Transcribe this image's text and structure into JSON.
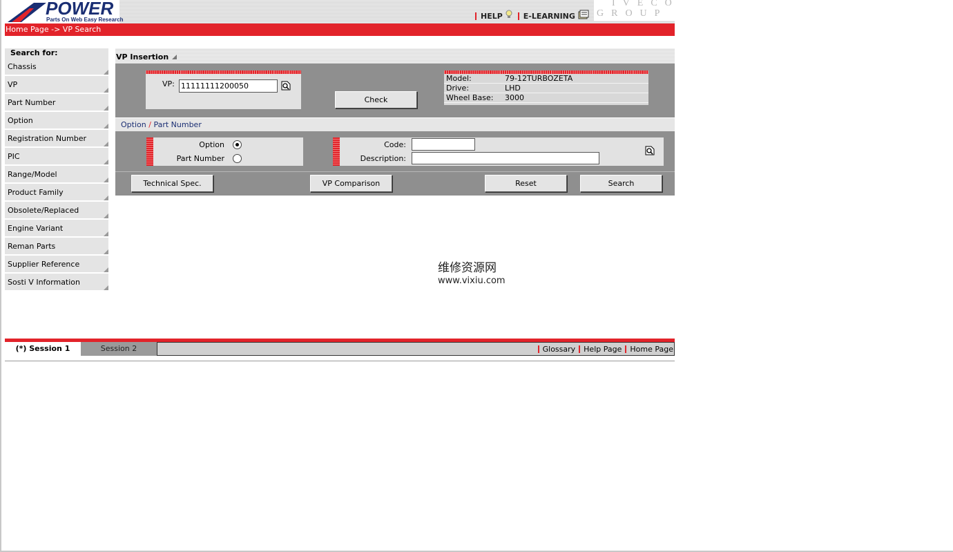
{
  "header": {
    "logo_text": "POWER",
    "logo_subtitle": "Parts On Web Easy Research",
    "help_label": "HELP",
    "elearning_label": "E-LEARNING",
    "brand_row1": "IVECO",
    "brand_row2": "GROUP"
  },
  "breadcrumb": "Home Page -> VP Search",
  "sidebar": {
    "title": "Search for:",
    "items": [
      {
        "label": "Chassis"
      },
      {
        "label": "VP"
      },
      {
        "label": "Part Number"
      },
      {
        "label": "Option"
      },
      {
        "label": "Registration Number"
      },
      {
        "label": "PIC"
      },
      {
        "label": "Range/Model"
      },
      {
        "label": "Product Family"
      },
      {
        "label": "Obsolete/Replaced"
      },
      {
        "label": "Engine Variant"
      },
      {
        "label": "Reman Parts"
      },
      {
        "label": "Supplier Reference"
      },
      {
        "label": "Sosti V Information"
      }
    ]
  },
  "vp_insertion": {
    "title": "VP Insertion",
    "vp_label": "VP:",
    "vp_value": "11111111200050",
    "check_label": "Check",
    "info": [
      {
        "key": "Model:",
        "value": "79-12TURBOZETA"
      },
      {
        "key": "Drive:",
        "value": "LHD"
      },
      {
        "key": "Wheel Base:",
        "value": "3000"
      }
    ]
  },
  "option_section": {
    "title_option": "Option",
    "title_sep": "/",
    "title_part": "Part Number",
    "radio_option_label": "Option",
    "radio_part_label": "Part Number",
    "selected": "Option",
    "code_label": "Code:",
    "code_value": "",
    "description_label": "Description:",
    "description_value": ""
  },
  "actions": {
    "tech_spec": "Technical Spec.",
    "vp_comparison": "VP Comparison",
    "reset": "Reset",
    "search": "Search"
  },
  "watermark": {
    "line1": "维修资源网",
    "line2": "www.vixiu.com"
  },
  "bottom": {
    "session1": "(*) Session 1",
    "session2": "Session 2",
    "glossary": "Glossary",
    "help_page": "Help Page",
    "home_page": "Home Page"
  },
  "colors": {
    "accent_red": "#e2232a",
    "panel_gray": "#8f8f8f",
    "logo_blue": "#1a2e73"
  }
}
